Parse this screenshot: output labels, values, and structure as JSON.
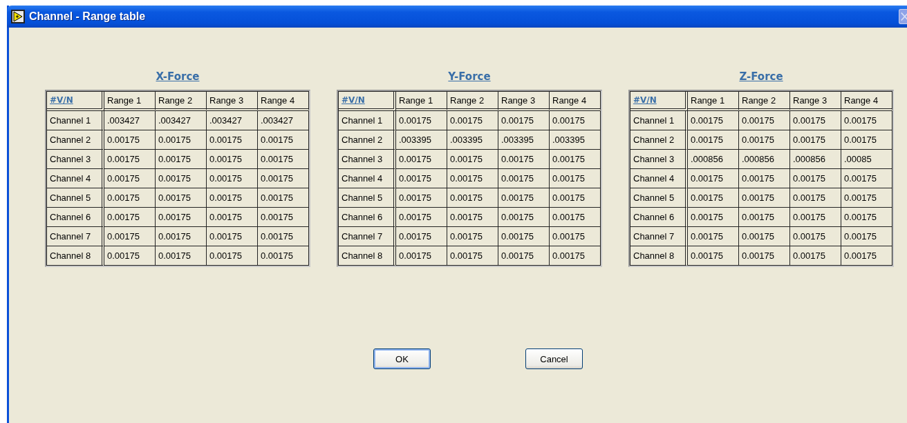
{
  "window": {
    "title": "Channel - Range table"
  },
  "tables": [
    {
      "title": "X-Force",
      "corner": "#V/N",
      "columns": [
        "Range 1",
        "Range 2",
        "Range 3",
        "Range 4"
      ],
      "rows": [
        {
          "label": "Channel 1",
          "cells": [
            ".003427",
            ".003427",
            ".003427",
            ".003427"
          ]
        },
        {
          "label": "Channel 2",
          "cells": [
            "0.00175",
            "0.00175",
            "0.00175",
            "0.00175"
          ]
        },
        {
          "label": "Channel 3",
          "cells": [
            "0.00175",
            "0.00175",
            "0.00175",
            "0.00175"
          ]
        },
        {
          "label": "Channel 4",
          "cells": [
            "0.00175",
            "0.00175",
            "0.00175",
            "0.00175"
          ]
        },
        {
          "label": "Channel 5",
          "cells": [
            "0.00175",
            "0.00175",
            "0.00175",
            "0.00175"
          ]
        },
        {
          "label": "Channel 6",
          "cells": [
            "0.00175",
            "0.00175",
            "0.00175",
            "0.00175"
          ]
        },
        {
          "label": "Channel 7",
          "cells": [
            "0.00175",
            "0.00175",
            "0.00175",
            "0.00175"
          ]
        },
        {
          "label": "Channel 8",
          "cells": [
            "0.00175",
            "0.00175",
            "0.00175",
            "0.00175"
          ]
        }
      ]
    },
    {
      "title": "Y-Force",
      "corner": "#V/N",
      "columns": [
        "Range 1",
        "Range 2",
        "Range 3",
        "Range 4"
      ],
      "rows": [
        {
          "label": "Channel 1",
          "cells": [
            "0.00175",
            "0.00175",
            "0.00175",
            "0.00175"
          ]
        },
        {
          "label": "Channel 2",
          "cells": [
            ".003395",
            ".003395",
            ".003395",
            ".003395"
          ]
        },
        {
          "label": "Channel 3",
          "cells": [
            "0.00175",
            "0.00175",
            "0.00175",
            "0.00175"
          ]
        },
        {
          "label": "Channel 4",
          "cells": [
            "0.00175",
            "0.00175",
            "0.00175",
            "0.00175"
          ]
        },
        {
          "label": "Channel 5",
          "cells": [
            "0.00175",
            "0.00175",
            "0.00175",
            "0.00175"
          ]
        },
        {
          "label": "Channel 6",
          "cells": [
            "0.00175",
            "0.00175",
            "0.00175",
            "0.00175"
          ]
        },
        {
          "label": "Channel 7",
          "cells": [
            "0.00175",
            "0.00175",
            "0.00175",
            "0.00175"
          ]
        },
        {
          "label": "Channel 8",
          "cells": [
            "0.00175",
            "0.00175",
            "0.00175",
            "0.00175"
          ]
        }
      ]
    },
    {
      "title": "Z-Force",
      "corner": "#V/N",
      "columns": [
        "Range 1",
        "Range 2",
        "Range 3",
        "Range 4"
      ],
      "rows": [
        {
          "label": "Channel 1",
          "cells": [
            "0.00175",
            "0.00175",
            "0.00175",
            "0.00175"
          ]
        },
        {
          "label": "Channel 2",
          "cells": [
            "0.00175",
            "0.00175",
            "0.00175",
            "0.00175"
          ]
        },
        {
          "label": "Channel 3",
          "cells": [
            ".000856",
            ".000856",
            ".000856",
            ".00085"
          ]
        },
        {
          "label": "Channel 4",
          "cells": [
            "0.00175",
            "0.00175",
            "0.00175",
            "0.00175"
          ]
        },
        {
          "label": "Channel 5",
          "cells": [
            "0.00175",
            "0.00175",
            "0.00175",
            "0.00175"
          ]
        },
        {
          "label": "Channel 6",
          "cells": [
            "0.00175",
            "0.00175",
            "0.00175",
            "0.00175"
          ]
        },
        {
          "label": "Channel 7",
          "cells": [
            "0.00175",
            "0.00175",
            "0.00175",
            "0.00175"
          ]
        },
        {
          "label": "Channel 8",
          "cells": [
            "0.00175",
            "0.00175",
            "0.00175",
            "0.00175"
          ]
        }
      ]
    }
  ],
  "buttons": [
    "OK",
    "Cancel"
  ]
}
